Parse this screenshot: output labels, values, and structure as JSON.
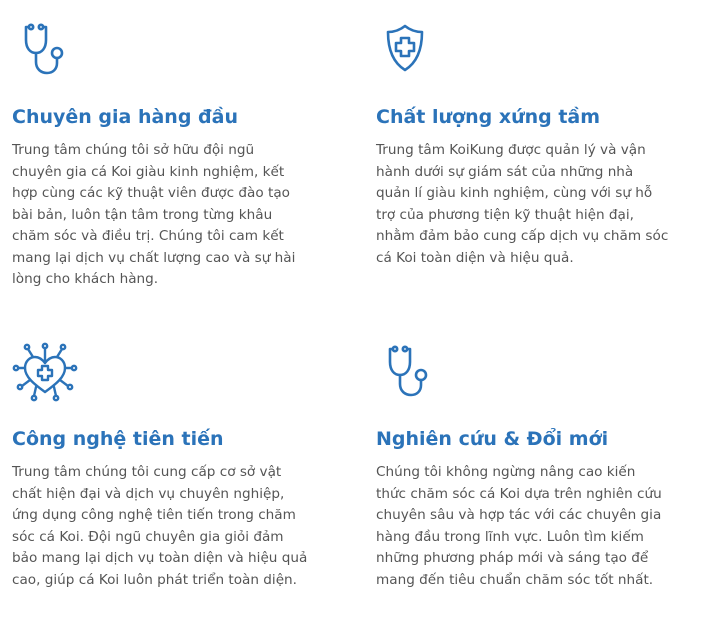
{
  "features": [
    {
      "icon": "stethoscope-icon",
      "title": "Chuyên gia hàng đầu",
      "lines": [
        "Trung tâm chúng tôi sở hữu đội ngũ",
        "chuyên gia cá Koi giàu kinh nghiệm, kết",
        "hợp cùng các kỹ thuật viên được đào tạo",
        "bài bản, luôn tận tâm trong từng khâu",
        "chăm sóc và điều trị. Chúng tôi cam kết",
        "mang lại dịch vụ chất lượng cao và sự hài",
        "lòng cho khách hàng."
      ]
    },
    {
      "icon": "shield-plus-icon",
      "title": "Chất lượng xứng tầm",
      "lines": [
        "Trung tâm KoiKung được quản lý và vận",
        "hành dưới sự giám sát của những nhà",
        "quản lí giàu kinh nghiệm, cùng với sự hỗ",
        "trợ của phương tiện kỹ thuật hiện đại,",
        "nhằm đảm bảo cung cấp dịch vụ chăm sóc",
        "cá Koi toàn diện và hiệu quả."
      ]
    },
    {
      "icon": "tech-heart-icon",
      "title": "Công nghệ tiên tiến",
      "lines": [
        "Trung tâm chúng tôi cung cấp cơ sở vật",
        "chất hiện đại và dịch vụ chuyên nghiệp,",
        "ứng dụng công nghệ tiên tiến trong chăm",
        "sóc cá Koi. Đội ngũ chuyên gia giỏi đảm",
        "bảo mang lại dịch vụ toàn diện và hiệu quả",
        "cao, giúp cá Koi luôn phát triển toàn diện."
      ]
    },
    {
      "icon": "stethoscope-icon",
      "title": "Nghiên cứu & Đổi mới",
      "lines": [
        "Chúng tôi không ngừng nâng cao kiến",
        "thức chăm sóc cá Koi dựa trên nghiên cứu",
        "chuyên sâu và hợp tác với các chuyên gia",
        "hàng đầu trong lĩnh vực. Luôn tìm kiếm",
        "những phương pháp mới và sáng tạo để",
        "mang đến tiêu chuẩn chăm sóc tốt nhất."
      ]
    }
  ],
  "colors": {
    "accent": "#2b73b9",
    "text": "#555555",
    "background": "#ffffff"
  }
}
